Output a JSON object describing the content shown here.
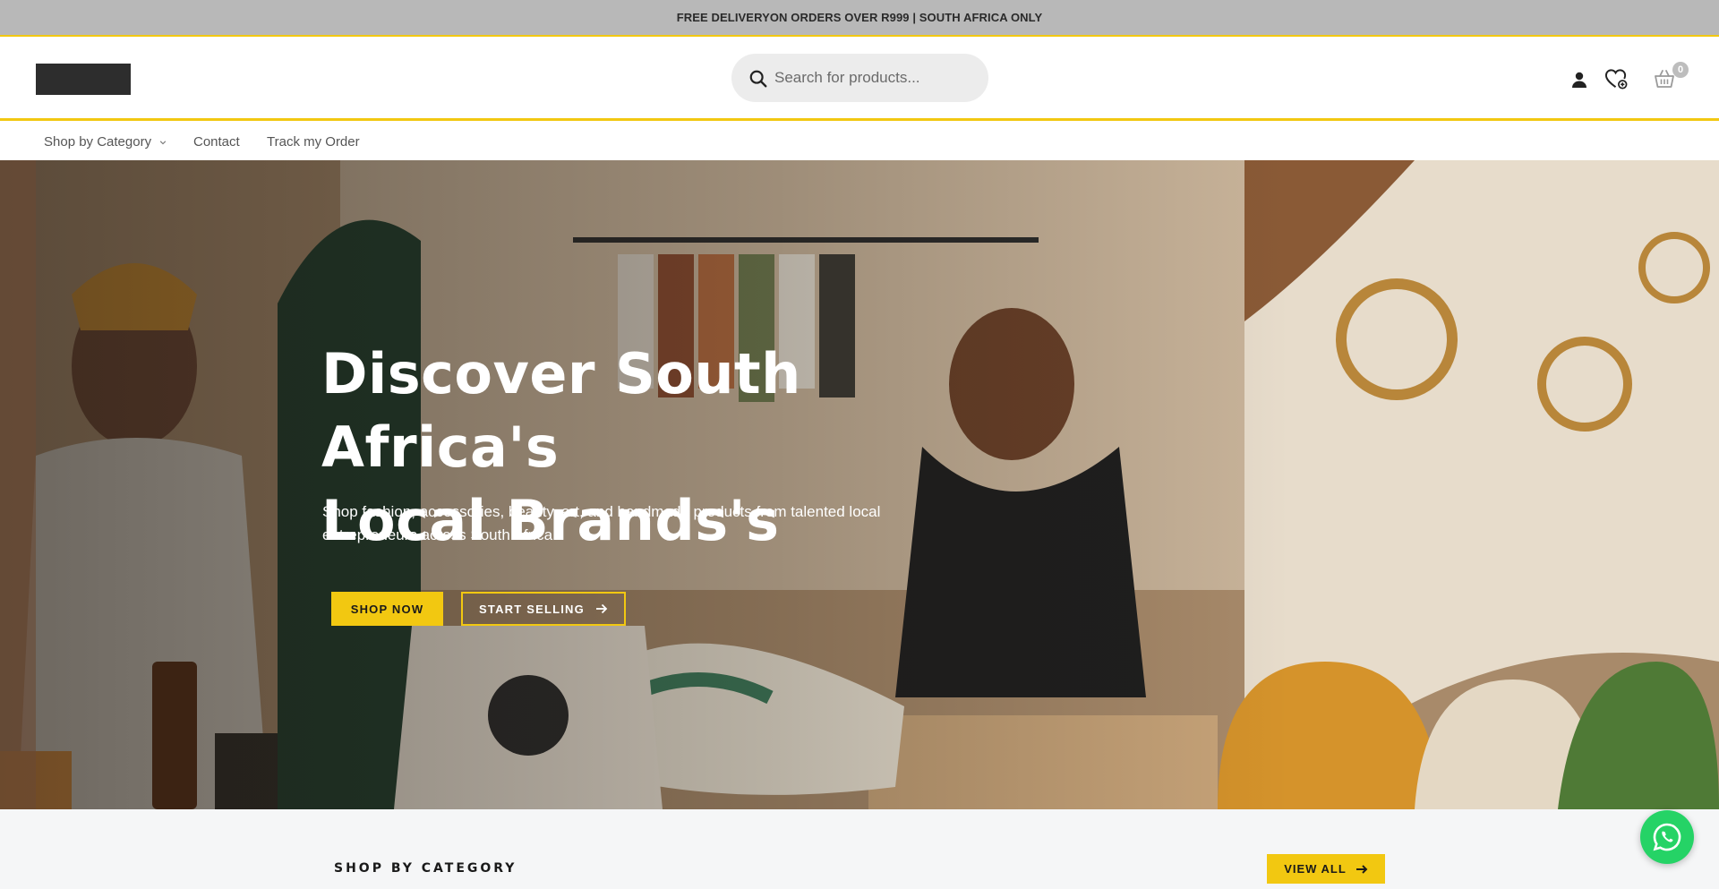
{
  "announcement": {
    "text": "FREE DELIVERYON ORDERS OVER R999 | SOUTH AFRICA ONLY"
  },
  "header": {
    "search": {
      "placeholder": "Search for products..."
    },
    "icons": [
      "user-icon",
      "wishlist-icon",
      "cart-icon",
      "search-icon"
    ],
    "cart_count": "0"
  },
  "nav": {
    "items": [
      {
        "label": "Shop by Category",
        "has_dropdown": true
      },
      {
        "label": "Contact"
      },
      {
        "label": "Track my Order"
      }
    ]
  },
  "hero": {
    "title_line1": "Discover South Africa's",
    "title_line2": "Local Brands's",
    "subtitle": "Shop fashion, accessories, beauty, art, and handmade products from talented local entrepreneurs across South Africa.",
    "primary_button": "SHOP NOW",
    "secondary_button": "START SELLING"
  },
  "categories": {
    "title": "SHOP BY CATEGORY",
    "view_all": "VIEW ALL"
  },
  "colors": {
    "accent": "#f2c811",
    "topbar_bg": "#b8b8b8",
    "whatsapp": "#25d366",
    "section_bg": "#f5f6f7"
  }
}
